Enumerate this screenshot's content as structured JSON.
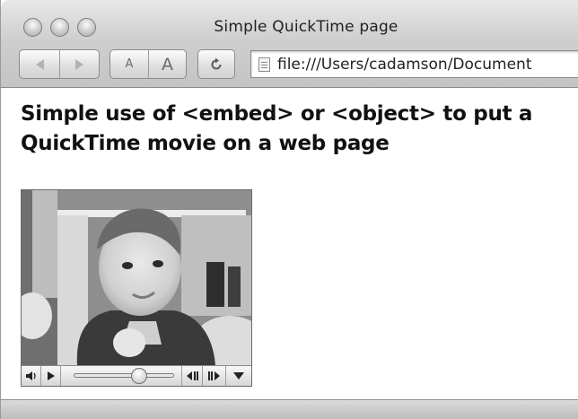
{
  "window": {
    "title": "Simple QuickTime page"
  },
  "toolbar": {
    "back_icon": "back-arrow-icon",
    "forward_icon": "forward-arrow-icon",
    "text_smaller_label": "A",
    "text_bigger_label": "A",
    "reload_icon": "reload-icon",
    "address_value": "file:///Users/cadamson/Document"
  },
  "page": {
    "heading": "Simple use of <embed> or <object> to put a QuickTime movie on a web page",
    "heading_line1": "Simple use of <embed> or <object> to put a",
    "heading_line2": "QuickTime movie on a web page"
  },
  "movie_controller": {
    "playhead_fraction": 0.65,
    "volume_icon": "speaker-icon",
    "play_icon": "play-icon",
    "step_back_icon": "step-back-icon",
    "step_forward_icon": "step-forward-icon",
    "menu_icon": "menu-triangle-icon"
  }
}
